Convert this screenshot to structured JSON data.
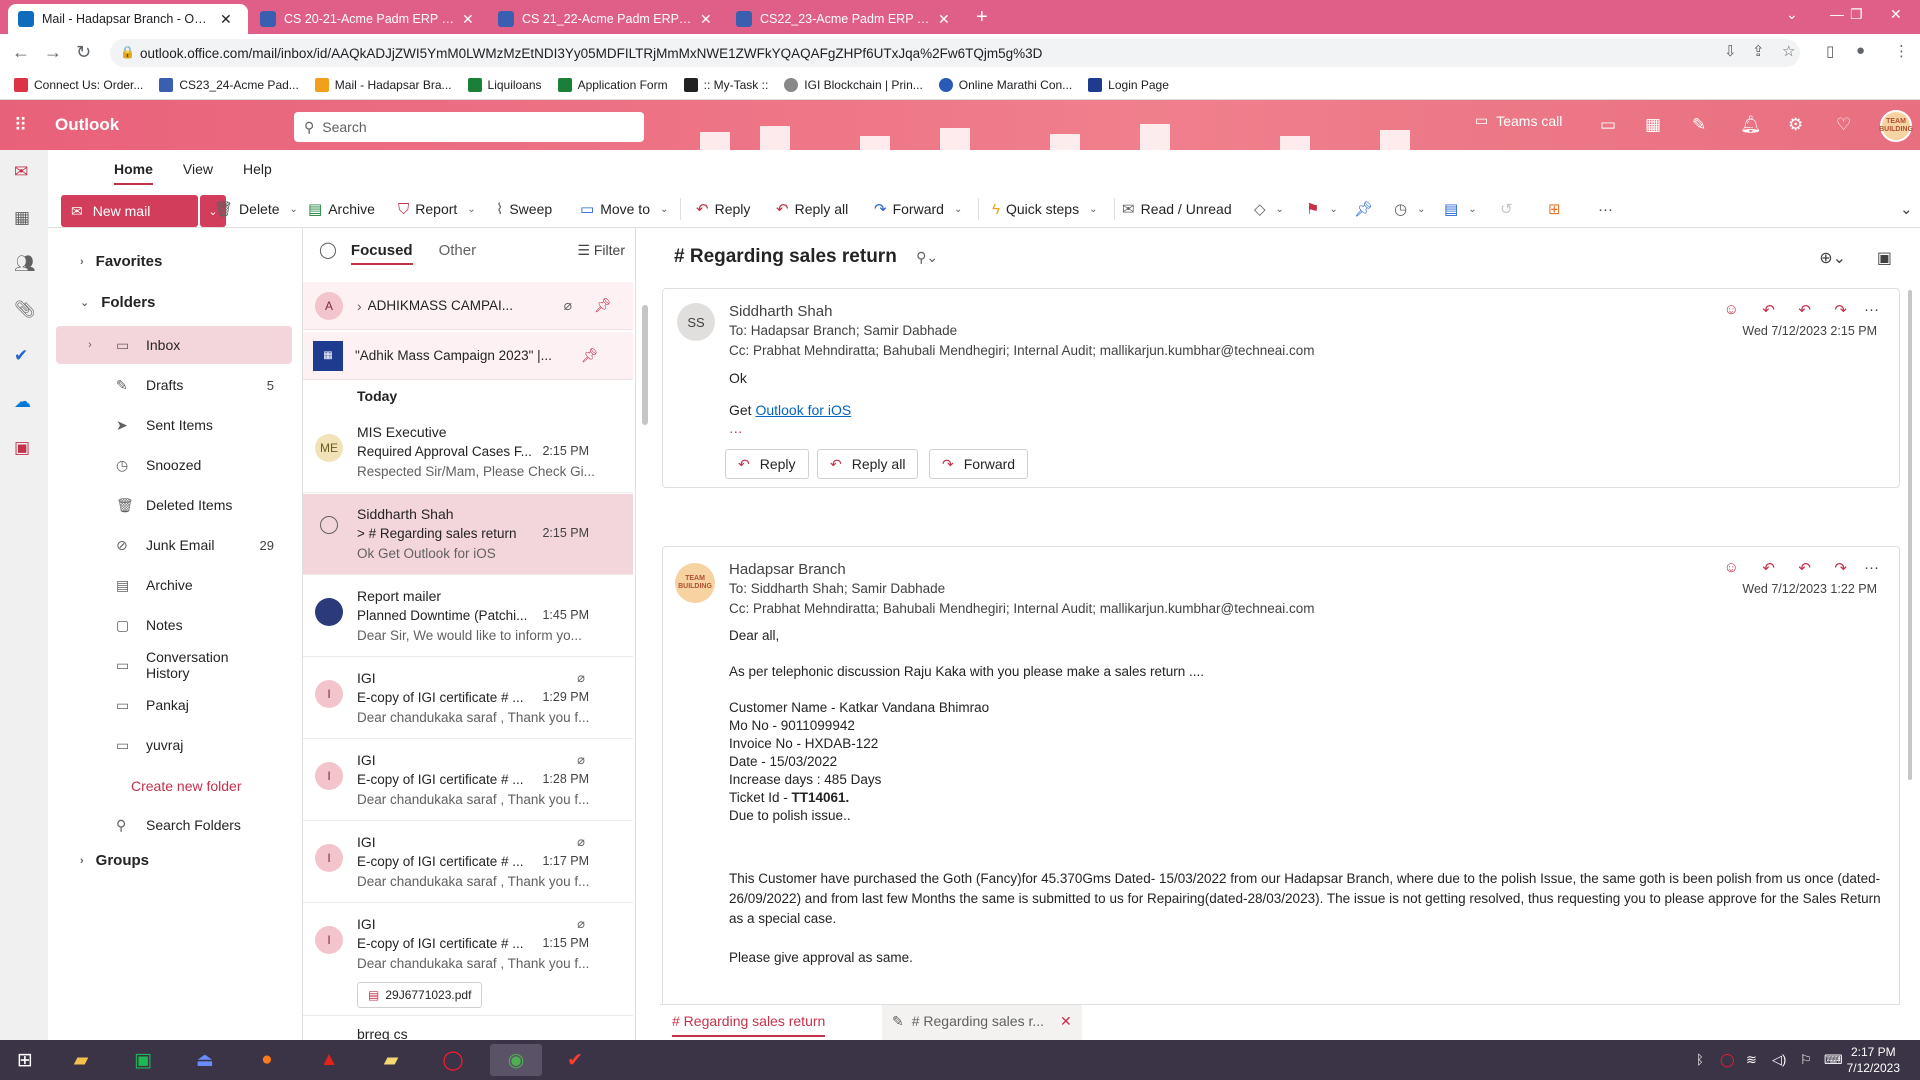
{
  "browser": {
    "tabs": [
      {
        "label": "Mail - Hadapsar Branch - Outlook",
        "active": true
      },
      {
        "label": "CS 20-21-Acme Padm ERP Platform",
        "active": false
      },
      {
        "label": "CS 21_22-Acme Padm ERP Platform",
        "active": false
      },
      {
        "label": "CS22_23-Acme Padm ERP Platform",
        "active": false
      }
    ],
    "url": "outlook.office.com/mail/inbox/id/AAQkADJjZWI5YmM0LWMzMzEtNDI3Yy05MDFILTRjMmMxNWE1ZWFkYQAQAFgZHPf6UTxJqa%2Fw6TQjm5g%3D",
    "bookmarks": [
      "Connect Us: Order...",
      "CS23_24-Acme Pad...",
      "Mail - Hadapsar Bra...",
      "Liquiloans",
      "Application Form",
      ":: My-Task ::",
      "IGI Blockchain | Prin...",
      "Online Marathi Con...",
      "Login Page"
    ]
  },
  "outlook": {
    "brand": "Outlook",
    "search_placeholder": "Search",
    "teams_call": "Teams call",
    "avatar_text": "TEAM BUILDING",
    "ribbon_tabs": [
      "Home",
      "View",
      "Help"
    ],
    "ribbon": {
      "new_mail": "New mail",
      "delete": "Delete",
      "archive": "Archive",
      "report": "Report",
      "sweep": "Sweep",
      "move_to": "Move to",
      "reply": "Reply",
      "reply_all": "Reply all",
      "forward": "Forward",
      "quick_steps": "Quick steps",
      "read_unread": "Read / Unread"
    }
  },
  "folders": {
    "favorites": "Favorites",
    "folders": "Folders",
    "groups": "Groups",
    "create_new": "Create new folder",
    "items": [
      {
        "label": "Inbox",
        "count": "",
        "icon": "inbox-icon"
      },
      {
        "label": "Drafts",
        "count": "5",
        "icon": "pencil-icon"
      },
      {
        "label": "Sent Items",
        "count": "",
        "icon": "send-icon"
      },
      {
        "label": "Snoozed",
        "count": "",
        "icon": "clock-icon"
      },
      {
        "label": "Deleted Items",
        "count": "",
        "icon": "trash-icon"
      },
      {
        "label": "Junk Email",
        "count": "29",
        "icon": "junk-icon"
      },
      {
        "label": "Archive",
        "count": "",
        "icon": "archive-icon"
      },
      {
        "label": "Notes",
        "count": "",
        "icon": "note-icon"
      },
      {
        "label": "Conversation History",
        "count": "",
        "icon": "folder-icon"
      },
      {
        "label": "Pankaj",
        "count": "",
        "icon": "folder-icon"
      },
      {
        "label": "yuvraj",
        "count": "",
        "icon": "folder-icon"
      }
    ],
    "search_folders": "Search Folders"
  },
  "message_list": {
    "tab_focused": "Focused",
    "tab_other": "Other",
    "filter": "Filter",
    "pinned": [
      {
        "avatar": "A",
        "text": "ADHIKMASS CAMPAI..."
      },
      {
        "avatar": "",
        "text": "\"Adhik Mass Campaign 2023\" |..."
      }
    ],
    "today": "Today",
    "messages": [
      {
        "avatar": "ME",
        "avatar_color": "#d9b86c",
        "from": "MIS Executive",
        "subject": "Required Approval Cases F...",
        "time": "2:15 PM",
        "preview": "Respected Sir/Mam, Please Check Gi...",
        "clip": false,
        "selected": false
      },
      {
        "avatar": "",
        "avatar_color": "",
        "from": "Siddharth Shah",
        "subject": "> # Regarding sales return",
        "time": "2:15 PM",
        "preview": "Ok Get Outlook for iOS",
        "clip": false,
        "selected": true
      },
      {
        "avatar": "",
        "avatar_color": "#2b3a7a",
        "from": "Report mailer",
        "subject": "Planned Downtime (Patchi...",
        "time": "1:45 PM",
        "preview": "Dear Sir, We would like to inform yo...",
        "clip": false,
        "selected": false
      },
      {
        "avatar": "I",
        "avatar_color": "#f3c4cc",
        "from": "IGI",
        "subject": "E-copy of IGI certificate # ...",
        "time": "1:29 PM",
        "preview": "Dear chandukaka saraf , Thank you f...",
        "clip": true,
        "selected": false
      },
      {
        "avatar": "I",
        "avatar_color": "#f3c4cc",
        "from": "IGI",
        "subject": "E-copy of IGI certificate # ...",
        "time": "1:28 PM",
        "preview": "Dear chandukaka saraf , Thank you f...",
        "clip": true,
        "selected": false
      },
      {
        "avatar": "I",
        "avatar_color": "#f3c4cc",
        "from": "IGI",
        "subject": "E-copy of IGI certificate # ...",
        "time": "1:17 PM",
        "preview": "Dear chandukaka saraf , Thank you f...",
        "clip": true,
        "selected": false
      },
      {
        "avatar": "I",
        "avatar_color": "#f3c4cc",
        "from": "IGI",
        "subject": "E-copy of IGI certificate # ...",
        "time": "1:15 PM",
        "preview": "Dear chandukaka saraf , Thank you f...",
        "clip": true,
        "selected": false
      }
    ],
    "attachment": "29J6771023.pdf",
    "next_from": "brreg cs"
  },
  "reading": {
    "title": "# Regarding sales return",
    "email1": {
      "initials": "SS",
      "sender": "Siddharth Shah",
      "to": "To:  Hadapsar Branch;  Samir Dabhade",
      "cc": "Cc:  Prabhat Mehndiratta;  Bahubali Mendhegiri;  Internal Audit;  mallikarjun.kumbhar@techneai.com",
      "date": "Wed 7/12/2023 2:15 PM",
      "body": "Ok",
      "get": "Get ",
      "link": "Outlook for iOS",
      "reply": "Reply",
      "reply_all": "Reply all",
      "forward": "Forward"
    },
    "email2": {
      "sender": "Hadapsar Branch",
      "to": "To:  Siddharth Shah;  Samir Dabhade",
      "cc": "Cc:  Prabhat Mehndiratta;  Bahubali Mendhegiri;  Internal Audit;  mallikarjun.kumbhar@techneai.com",
      "date": "Wed 7/12/2023 1:22 PM",
      "avatar_text": "TEAM BUILDING",
      "greeting": "Dear all,",
      "line1": "As per telephonic discussion Raju Kaka with you please make a sales return ....",
      "details": [
        "Customer Name - Katkar Vandana Bhimrao",
        "Mo No - 9011099942",
        "Invoice No - HXDAB-122",
        "Date - 15/03/2022",
        "Increase days : 485 Days"
      ],
      "ticket_label": "Ticket Id - ",
      "ticket_id": "TT14061.",
      "polish": "Due to polish issue..",
      "para": "This Customer have purchased the Goth (Fancy)for 45.370Gms Dated- 15/03/2022  from our Hadapsar Branch, where due to the polish Issue, the same goth is been polish from us once (dated-26/09/2022) and from last few Months the same is submitted to us for Repairing(dated-28/03/2023). The issue is not getting resolved, thus requesting you to please approve for the Sales Return as a special case.",
      "closing": "Please give approval as same."
    },
    "draft_tabs": [
      "# Regarding sales return",
      "# Regarding sales r..."
    ]
  },
  "taskbar": {
    "time": "2:17 PM",
    "date": "7/12/2023"
  }
}
